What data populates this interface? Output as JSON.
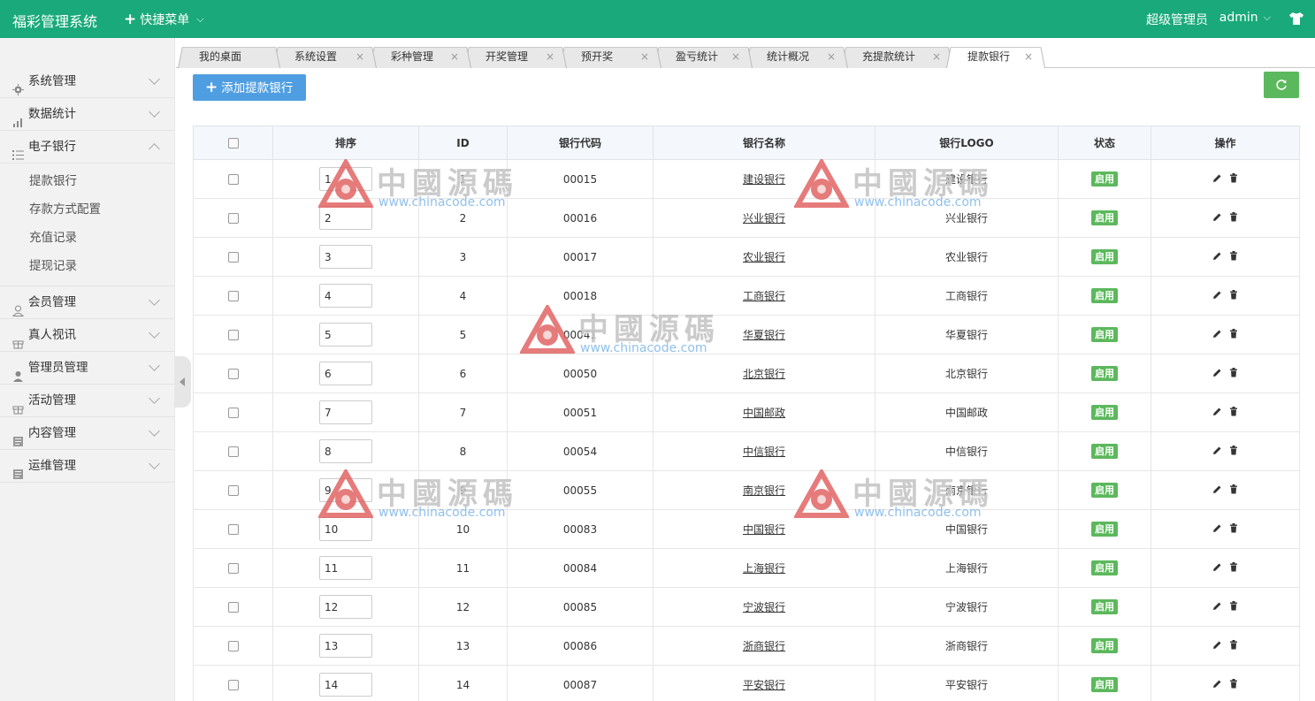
{
  "header": {
    "brand": "福彩管理系统",
    "quick_menu": "快捷菜单",
    "role": "超级管理员",
    "username": "admin"
  },
  "sidebar": {
    "items": [
      {
        "label": "系统管理",
        "icon": "gear-icon"
      },
      {
        "label": "数据统计",
        "icon": "chart-icon"
      },
      {
        "label": "电子银行",
        "icon": "list-icon",
        "expanded": true,
        "children": [
          "提款银行",
          "存款方式配置",
          "充值记录",
          "提现记录"
        ]
      },
      {
        "label": "会员管理",
        "icon": "user-outline-icon"
      },
      {
        "label": "真人视讯",
        "icon": "gift-icon"
      },
      {
        "label": "管理员管理",
        "icon": "user-solid-icon"
      },
      {
        "label": "活动管理",
        "icon": "gift-icon"
      },
      {
        "label": "内容管理",
        "icon": "book-icon"
      },
      {
        "label": "运维管理",
        "icon": "book-icon"
      }
    ]
  },
  "tabs": [
    {
      "label": "我的桌面",
      "closable": false
    },
    {
      "label": "系统设置",
      "closable": true
    },
    {
      "label": "彩种管理",
      "closable": true
    },
    {
      "label": "开奖管理",
      "closable": true
    },
    {
      "label": "预开奖",
      "closable": true
    },
    {
      "label": "盈亏统计",
      "closable": true
    },
    {
      "label": "统计概况",
      "closable": true
    },
    {
      "label": "充提款统计",
      "closable": true
    },
    {
      "label": "提款银行",
      "closable": true,
      "active": true
    }
  ],
  "toolbar": {
    "add_label": "添加提款银行"
  },
  "table": {
    "columns": [
      "排序",
      "ID",
      "银行代码",
      "银行名称",
      "银行LOGO",
      "状态",
      "操作"
    ],
    "rows": [
      {
        "sort": "1",
        "id": "1",
        "code": "00015",
        "name": "建设银行",
        "logo": "建设银行",
        "status": "启用"
      },
      {
        "sort": "2",
        "id": "2",
        "code": "00016",
        "name": "兴业银行",
        "logo": "兴业银行",
        "status": "启用"
      },
      {
        "sort": "3",
        "id": "3",
        "code": "00017",
        "name": "农业银行",
        "logo": "农业银行",
        "status": "启用"
      },
      {
        "sort": "4",
        "id": "4",
        "code": "00018",
        "name": "工商银行",
        "logo": "工商银行",
        "status": "启用"
      },
      {
        "sort": "5",
        "id": "5",
        "code": "00041",
        "name": "华夏银行",
        "logo": "华夏银行",
        "status": "启用"
      },
      {
        "sort": "6",
        "id": "6",
        "code": "00050",
        "name": "北京银行",
        "logo": "北京银行",
        "status": "启用"
      },
      {
        "sort": "7",
        "id": "7",
        "code": "00051",
        "name": "中国邮政",
        "logo": "中国邮政",
        "status": "启用"
      },
      {
        "sort": "8",
        "id": "8",
        "code": "00054",
        "name": "中信银行",
        "logo": "中信银行",
        "status": "启用"
      },
      {
        "sort": "9",
        "id": "9",
        "code": "00055",
        "name": "南京银行",
        "logo": "南京银行",
        "status": "启用"
      },
      {
        "sort": "10",
        "id": "10",
        "code": "00083",
        "name": "中国银行",
        "logo": "中国银行",
        "status": "启用"
      },
      {
        "sort": "11",
        "id": "11",
        "code": "00084",
        "name": "上海银行",
        "logo": "上海银行",
        "status": "启用"
      },
      {
        "sort": "12",
        "id": "12",
        "code": "00085",
        "name": "宁波银行",
        "logo": "宁波银行",
        "status": "启用"
      },
      {
        "sort": "13",
        "id": "13",
        "code": "00086",
        "name": "浙商银行",
        "logo": "浙商银行",
        "status": "启用"
      },
      {
        "sort": "14",
        "id": "14",
        "code": "00087",
        "name": "平安银行",
        "logo": "平安银行",
        "status": "启用"
      }
    ]
  },
  "watermark": {
    "title": "中國源碼",
    "url": "www.chinacode.com"
  },
  "colors": {
    "header": "#1aa97a",
    "primary_button": "#4f9ee1",
    "success": "#5cb85c",
    "watermark_red": "#e05a5a"
  }
}
